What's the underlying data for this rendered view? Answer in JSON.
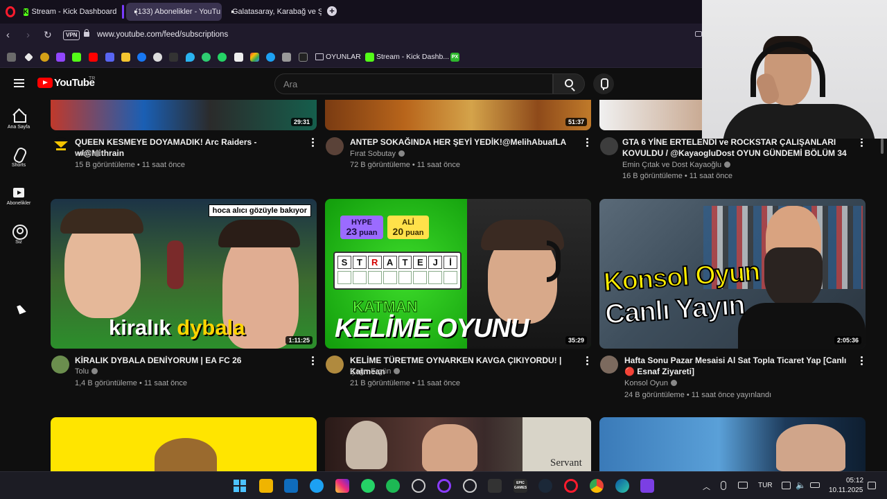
{
  "browser": {
    "tabs": [
      {
        "title": "Stream - Kick Dashboard",
        "favicon": "kick-icon"
      },
      {
        "title": "(133) Abonelikler - YouTu",
        "favicon": "youtube-icon",
        "active": true
      },
      {
        "title": "Galatasaray, Karabağ ve Ş",
        "favicon": "youtube-icon"
      }
    ],
    "vpn_label": "VPN",
    "url": "www.youtube.com/feed/subscriptions",
    "bookmarks": {
      "folder_label": "OYUNLAR",
      "kick_label": "Stream - Kick Dashb...",
      "px_label": "PX"
    }
  },
  "youtube": {
    "logo_text": "YouTube",
    "country_code": "TR",
    "search_placeholder": "Ara",
    "sidebar": [
      {
        "label": "Ana Sayfa",
        "icon": "home-icon"
      },
      {
        "label": "Shorts",
        "icon": "shorts-icon"
      },
      {
        "label": "Abonelikler",
        "icon": "subscriptions-icon"
      },
      {
        "label": "Siz",
        "icon": "you-icon"
      }
    ],
    "videos": [
      {
        "title": "QUEEN KESMEYE DOYAMADIK!  Arc Raiders - w/@Mithrain",
        "channel": "wtcN",
        "meta": "15 B görüntüleme • 11 saat önce",
        "duration": "29:31"
      },
      {
        "title": "ANTEP SOKAĞINDA HER ŞEYİ YEDİK!@MelihAbuafLA",
        "channel": "Fırat Sobutay",
        "meta": "72 B görüntüleme • 11 saat önce",
        "duration": "51:37"
      },
      {
        "title": "GTA 6 YİNE ERTELENDİ ve ROCKSTAR ÇALIŞANLARI KOVULDU / @KayaogluDost OYUN GÜNDEMİ BÖLÜM 34",
        "channel": "Emin Çıtak ve Dost Kayaoğlu",
        "meta": "16 B görüntüleme • 11 saat önce",
        "duration": ""
      },
      {
        "title": "KİRALIK DYBALA DENİYORUM | EA FC 26",
        "channel": "Tolu",
        "meta": "1,4 B görüntüleme • 11 saat önce",
        "duration": "1:11:25",
        "thumb_text_1": "kiralık",
        "thumb_text_2": "dybala",
        "thumb_tag": "hoca alıcı gözüyle bakıyor"
      },
      {
        "title": "KELİME TÜRETME OYNARKEN KAVGA ÇIKIYORDU! | Katmean",
        "channel": "Çağrı Ergün",
        "meta": "21 B görüntüleme • 11 saat önce",
        "duration": "35:29",
        "thumb_line1": "KATMAN",
        "thumb_line2": "KELİME OYUNU",
        "hype_label": "HYPE",
        "hype_score": "23",
        "ali_label": "ALİ",
        "ali_score": "20",
        "points_label": "puan",
        "tiles": [
          "S",
          "T",
          "R",
          "A",
          "T",
          "E",
          "J",
          "İ"
        ]
      },
      {
        "title": "Hafta Sonu Pazar  Mesaisi Al Sat Topla Ticaret Yap [Canlı 🔴 Esnaf Ziyareti]",
        "channel": "Konsol Oyun",
        "meta": "24 B görüntüleme • 11 saat önce yayınlandı",
        "duration": "2:05:36",
        "thumb_line1": "Konsol Oyun",
        "thumb_line2": "Canlı Yayın"
      },
      {
        "title": "",
        "channel": "",
        "meta": "",
        "duration": ""
      },
      {
        "title": "",
        "channel": "",
        "meta": "",
        "duration": "",
        "thumb_label": "Servant"
      },
      {
        "title": "",
        "channel": "",
        "meta": "",
        "duration": ""
      }
    ]
  },
  "taskbar": {
    "language": "TUR",
    "time": "05:12",
    "date": "10.11.2025",
    "epic_label": "EPIC GAMES"
  },
  "colors": {
    "accent": "#ff0000",
    "kick_green": "#53fc18",
    "opera_red": "#ff1b2d"
  }
}
